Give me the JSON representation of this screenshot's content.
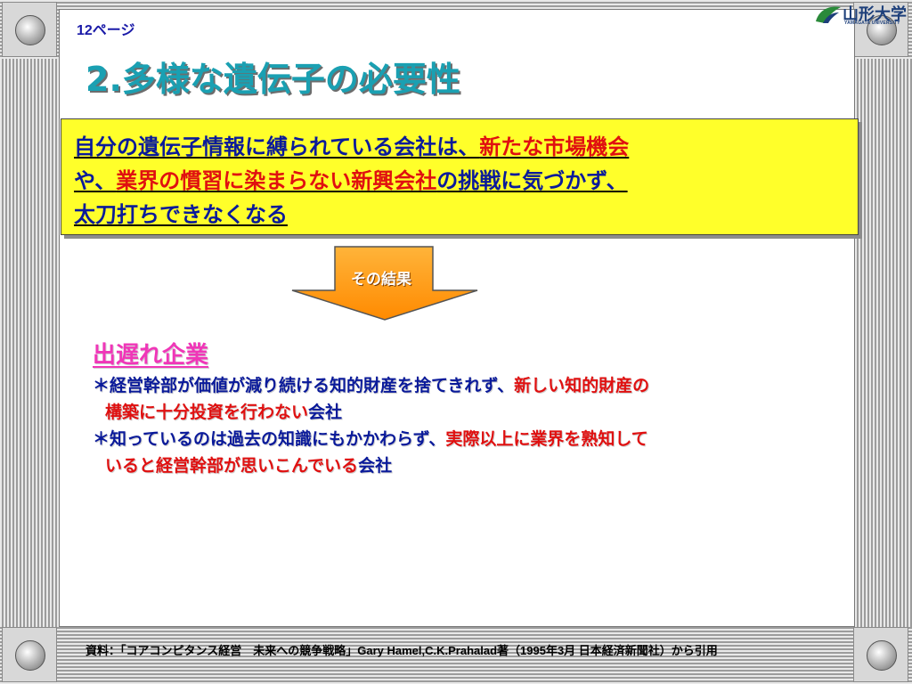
{
  "page_number": "12ページ",
  "logo": {
    "name": "山形大学",
    "sub": "YAMAGATA UNIVERSITY",
    "mark_icon": "leaf-logo-icon"
  },
  "title": "2.多様な遺伝子の必要性",
  "box": {
    "line1_a": "自分の遺伝子情報に縛られている会社は、",
    "line1_b": "新たな市場機会",
    "line2_a": "や、",
    "line2_b": "業界の慣習に染まらない新興会社",
    "line2_c": "の挑戦に気づかず、",
    "line3": "太刀打ちできなくなる"
  },
  "arrow": {
    "label": "その結果",
    "icon": "down-arrow-icon",
    "fill_color": "#ff9a1a"
  },
  "heading": "出遅れ企業",
  "bullets": [
    {
      "l1_a": "＊経営幹部が価値が減り続ける知的財産を捨てきれず、",
      "l1_b": "新しい知的財産の",
      "l2_a": "構築に十分投資を行わない",
      "l2_b": "会社"
    },
    {
      "l1_a": "＊知っているのは過去の知識にもかかわらず、",
      "l1_b": "実際以上に業界を熟知して",
      "l2_a": "いると経営幹部が思いこんでいる",
      "l2_b": "会社"
    }
  ],
  "citation": "資料：「コアコンピタンス経営　未来への競争戦略」Gary Hamel,C.K.Prahalad著（1995年3月 日本経済新聞社）から引用",
  "colors": {
    "title": "#1aa0b2",
    "blue_text": "#0a1a9a",
    "red_text": "#e01010",
    "pink_heading": "#f036b8",
    "box_yellow": "#ffff2a"
  }
}
